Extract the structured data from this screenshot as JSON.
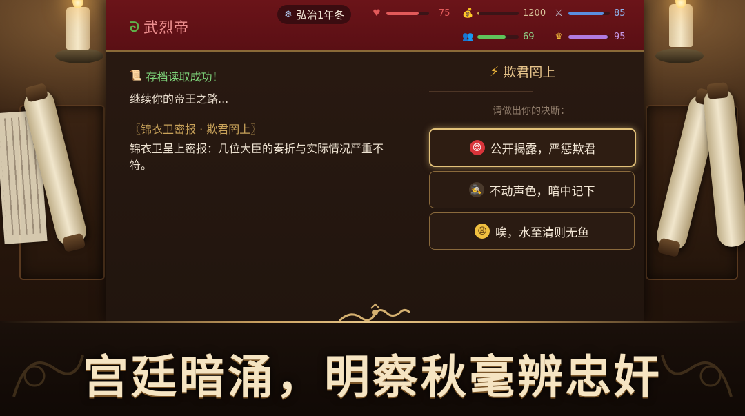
{
  "header": {
    "title": "武烈帝",
    "title_icon": "dragon-icon",
    "season": "弘治1年冬",
    "season_icon": "snowflake-icon"
  },
  "stats": [
    {
      "key": "health",
      "icon": "heart-icon",
      "value": "75",
      "fraction": 0.75,
      "color": "#e25a5a"
    },
    {
      "key": "treasury",
      "icon": "money-bag-icon",
      "value": "1200",
      "fraction": 0.03,
      "color": "#d4a64a"
    },
    {
      "key": "military",
      "icon": "crossed-swords-icon",
      "value": "85",
      "fraction": 0.85,
      "color": "#5a8ee0"
    },
    {
      "key": "people",
      "icon": "people-icon",
      "value": "69",
      "fraction": 0.69,
      "color": "#5fc45a"
    },
    {
      "key": "prestige",
      "icon": "crown-icon",
      "value": "95",
      "fraction": 0.95,
      "color": "#b07be0"
    }
  ],
  "story": {
    "save_icon": "scroll-icon",
    "save_message": "存档读取成功！",
    "continue_text": "继续你的帝王之路...",
    "report_title": "〖锦衣卫密报 · 欺君罔上〗",
    "report_body": "锦衣卫呈上密报：几位大臣的奏折与实际情况严重不符。"
  },
  "event": {
    "icon": "lightning-icon",
    "title": "欺君罔上",
    "prompt": "请做出你的决断："
  },
  "choices": [
    {
      "icon": "angry-face-icon",
      "label": "公开揭露，严惩欺君",
      "active": true
    },
    {
      "icon": "detective-icon",
      "label": "不动声色，暗中记下",
      "active": false
    },
    {
      "icon": "weary-face-icon",
      "label": "唉，水至清则无鱼",
      "active": false
    }
  ],
  "banner": {
    "slogan": "宫廷暗涌，明察秋毫辨忠奸"
  }
}
